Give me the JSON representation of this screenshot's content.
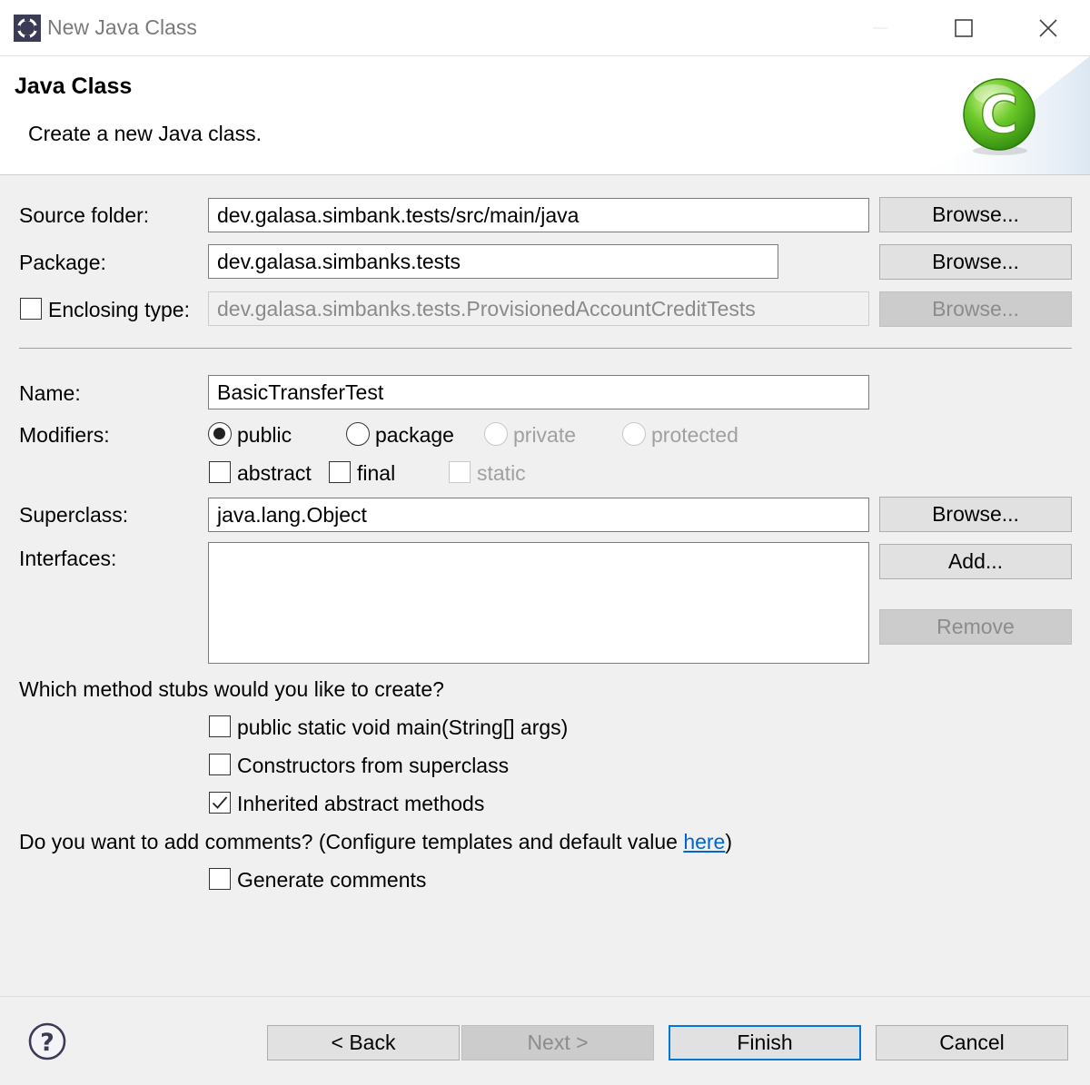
{
  "window": {
    "title": "New Java Class",
    "minimize_icon": "minimize-icon",
    "maximize_icon": "maximize-icon",
    "close_icon": "close-icon"
  },
  "header": {
    "title": "Java Class",
    "description": "Create a new Java class.",
    "logo_letter": "C"
  },
  "form": {
    "source_folder": {
      "label": "Source folder:",
      "value": "dev.galasa.simbank.tests/src/main/java",
      "browse": "Browse..."
    },
    "package": {
      "label": "Package:",
      "value": "dev.galasa.simbanks.tests",
      "browse": "Browse..."
    },
    "enclosing_type": {
      "label": "Enclosing type:",
      "value": "dev.galasa.simbanks.tests.ProvisionedAccountCreditTests",
      "browse": "Browse...",
      "checked": false
    },
    "name": {
      "label": "Name:",
      "value": "BasicTransferTest"
    },
    "modifiers": {
      "label": "Modifiers:",
      "radios": [
        {
          "label": "public",
          "selected": true,
          "enabled": true
        },
        {
          "label": "package",
          "selected": false,
          "enabled": true
        },
        {
          "label": "private",
          "selected": false,
          "enabled": false
        },
        {
          "label": "protected",
          "selected": false,
          "enabled": false
        }
      ],
      "checks": [
        {
          "label": "abstract",
          "checked": false,
          "enabled": true
        },
        {
          "label": "final",
          "checked": false,
          "enabled": true
        },
        {
          "label": "static",
          "checked": false,
          "enabled": false
        }
      ]
    },
    "superclass": {
      "label": "Superclass:",
      "value": "java.lang.Object",
      "browse": "Browse..."
    },
    "interfaces": {
      "label": "Interfaces:",
      "add": "Add...",
      "remove": "Remove"
    }
  },
  "stubs": {
    "question": "Which method stubs would you like to create?",
    "options": [
      {
        "label": "public static void main(String[] args)",
        "checked": false
      },
      {
        "label": "Constructors from superclass",
        "checked": false
      },
      {
        "label": "Inherited abstract methods",
        "checked": true
      }
    ]
  },
  "comments": {
    "question_before": "Do you want to add comments? (Configure templates and default value ",
    "link": "here",
    "question_after": ")",
    "option": {
      "label": "Generate comments",
      "checked": false
    }
  },
  "footer": {
    "help_icon": "help-icon",
    "help_glyph": "?",
    "back": "< Back",
    "next": "Next >",
    "finish": "Finish",
    "cancel": "Cancel"
  }
}
